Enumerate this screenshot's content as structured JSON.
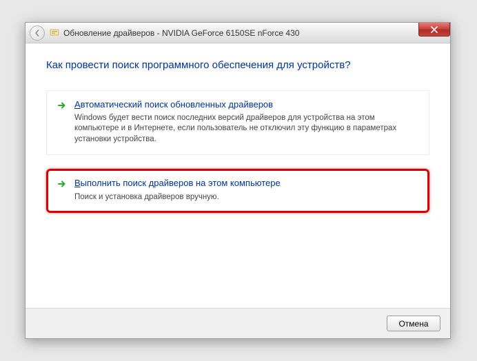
{
  "titlebar": {
    "title": "Обновление драйверов - NVIDIA GeForce 6150SE nForce 430"
  },
  "heading": "Как провести поиск программного обеспечения для устройств?",
  "options": {
    "auto": {
      "title_pre": "А",
      "title_rest": "втоматический поиск обновленных драйверов",
      "desc": "Windows будет вести поиск последних версий драйверов для устройства на этом компьютере и в Интернете, если пользователь не отключил эту функцию в параметрах установки устройства."
    },
    "manual": {
      "title_pre": "В",
      "title_rest": "ыполнить поиск драйверов на этом компьютере",
      "desc": "Поиск и установка драйверов вручную."
    }
  },
  "footer": {
    "cancel": "Отмена"
  }
}
